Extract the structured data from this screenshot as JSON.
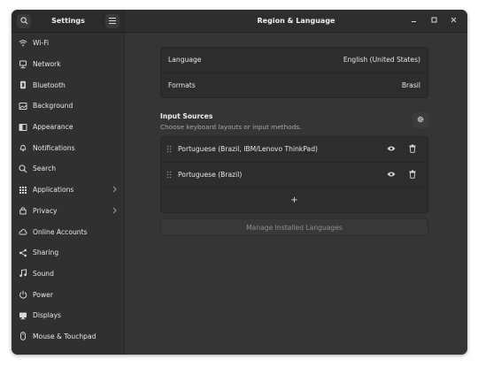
{
  "sidebar": {
    "title": "Settings",
    "search_icon": "search-icon",
    "menu_icon": "hamburger-menu-icon",
    "items": [
      {
        "label": "Wi-Fi",
        "icon": "wifi-icon"
      },
      {
        "label": "Network",
        "icon": "network-icon"
      },
      {
        "label": "Bluetooth",
        "icon": "bluetooth-icon"
      },
      {
        "label": "Background",
        "icon": "background-icon"
      },
      {
        "label": "Appearance",
        "icon": "appearance-icon"
      },
      {
        "label": "Notifications",
        "icon": "bell-icon"
      },
      {
        "label": "Search",
        "icon": "search-icon"
      },
      {
        "label": "Applications",
        "icon": "applications-icon",
        "has_submenu": true
      },
      {
        "label": "Privacy",
        "icon": "privacy-icon",
        "has_submenu": true
      },
      {
        "label": "Online Accounts",
        "icon": "cloud-icon"
      },
      {
        "label": "Sharing",
        "icon": "share-icon"
      },
      {
        "label": "Sound",
        "icon": "music-note-icon"
      },
      {
        "label": "Power",
        "icon": "power-icon"
      },
      {
        "label": "Displays",
        "icon": "display-icon"
      },
      {
        "label": "Mouse & Touchpad",
        "icon": "mouse-icon"
      }
    ]
  },
  "main": {
    "title": "Region & Language",
    "language_label": "Language",
    "language_value": "English (United States)",
    "formats_label": "Formats",
    "formats_value": "Brasil",
    "input_sources": {
      "title": "Input Sources",
      "subtitle": "Choose keyboard layouts or input methods.",
      "items": [
        {
          "label": "Portuguese (Brazil, IBM/Lenovo ThinkPad)"
        },
        {
          "label": "Portuguese (Brazil)"
        }
      ],
      "add_label": "+"
    },
    "manage_button": "Manage Installed Languages"
  },
  "window_controls": [
    "minimize",
    "maximize",
    "close"
  ],
  "colors": {
    "window_bg": "#353535",
    "sidebar_bg": "#303030",
    "card_bg": "#2d2d2d",
    "text": "#e8e8e8",
    "muted_text": "#a9a9a9"
  }
}
